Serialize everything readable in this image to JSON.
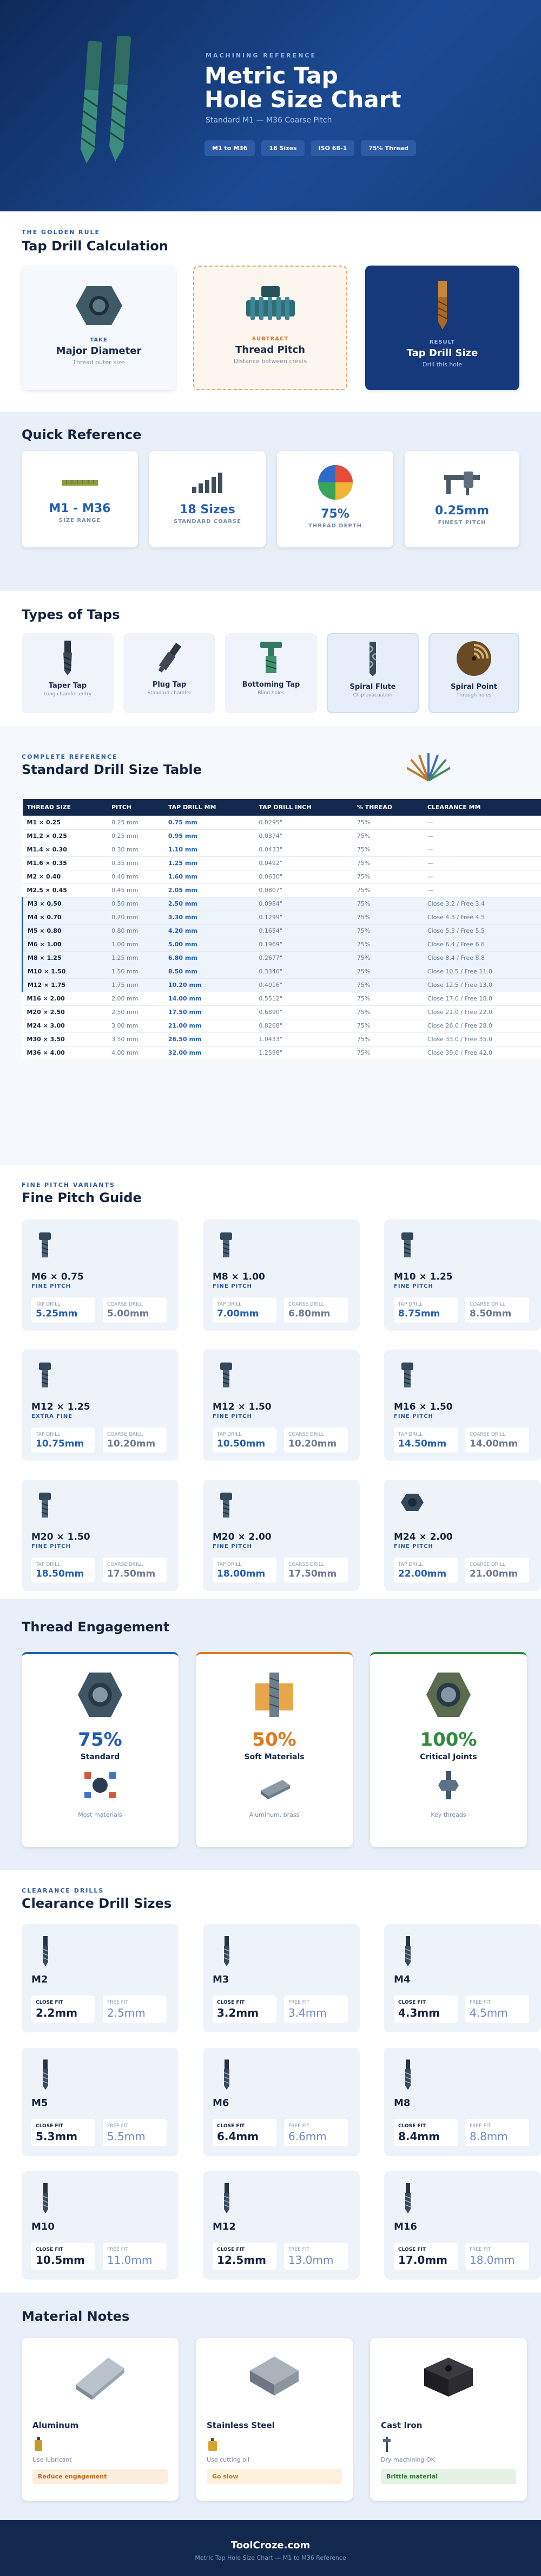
{
  "header": {
    "kicker": "MACHINING REFERENCE",
    "title_line1": "Metric Tap",
    "title_line2": "Hole Size Chart",
    "subtitle": "Standard M1 — M36 Coarse Pitch",
    "chips": [
      "M1 to M36",
      "18 Sizes",
      "ISO 68-1",
      "75% Thread"
    ]
  },
  "golden": {
    "kicker": "THE GOLDEN RULE",
    "title": "Tap Drill Calculation",
    "cards": [
      {
        "label": "TAKE",
        "title": "Major Diameter",
        "desc": "Thread outer size"
      },
      {
        "label": "SUBTRACT",
        "title": "Thread Pitch",
        "desc": "Distance between crests"
      },
      {
        "label": "RESULT",
        "title": "Tap Drill Size",
        "desc": "Drill this hole"
      }
    ]
  },
  "quick": {
    "title": "Quick Reference",
    "cards": [
      {
        "value": "M1 - M36",
        "label": "SIZE RANGE"
      },
      {
        "value": "18 Sizes",
        "label": "STANDARD COARSE"
      },
      {
        "value": "75%",
        "label": "THREAD DEPTH"
      },
      {
        "value": "0.25mm",
        "label": "FINEST PITCH"
      }
    ]
  },
  "taps": {
    "title": "Types of Taps",
    "items": [
      {
        "name": "Taper Tap",
        "desc": "Long chamfer entry"
      },
      {
        "name": "Plug Tap",
        "desc": "Standard chamfer"
      },
      {
        "name": "Bottoming Tap",
        "desc": "Blind holes"
      },
      {
        "name": "Spiral Flute",
        "desc": "Chip evacuation"
      },
      {
        "name": "Spiral Point",
        "desc": "Through holes"
      }
    ]
  },
  "table": {
    "kicker": "COMPLETE REFERENCE",
    "title": "Standard Drill Size Table",
    "headers": [
      "THREAD SIZE",
      "PITCH",
      "TAP DRILL MM",
      "TAP DRILL INCH",
      "% THREAD",
      "CLEARANCE MM"
    ],
    "rows": [
      [
        "M1 × 0.25",
        "0.25 mm",
        "0.75 mm",
        "0.0295\"",
        "75%",
        "—"
      ],
      [
        "M1.2 × 0.25",
        "0.25 mm",
        "0.95 mm",
        "0.0374\"",
        "75%",
        "—"
      ],
      [
        "M1.4 × 0.30",
        "0.30 mm",
        "1.10 mm",
        "0.0433\"",
        "75%",
        "—"
      ],
      [
        "M1.6 × 0.35",
        "0.35 mm",
        "1.25 mm",
        "0.0492\"",
        "75%",
        "—"
      ],
      [
        "M2 × 0.40",
        "0.40 mm",
        "1.60 mm",
        "0.0630\"",
        "75%",
        "—"
      ],
      [
        "M2.5 × 0.45",
        "0.45 mm",
        "2.05 mm",
        "0.0807\"",
        "75%",
        "—"
      ],
      [
        "M3 × 0.50",
        "0.50 mm",
        "2.50 mm",
        "0.0984\"",
        "75%",
        "Close 3.2 / Free 3.4"
      ],
      [
        "M4 × 0.70",
        "0.70 mm",
        "3.30 mm",
        "0.1299\"",
        "75%",
        "Close 4.3 / Free 4.5"
      ],
      [
        "M5 × 0.80",
        "0.80 mm",
        "4.20 mm",
        "0.1654\"",
        "75%",
        "Close 5.3 / Free 5.5"
      ],
      [
        "M6 × 1.00",
        "1.00 mm",
        "5.00 mm",
        "0.1969\"",
        "75%",
        "Close 6.4 / Free 6.6"
      ],
      [
        "M8 × 1.25",
        "1.25 mm",
        "6.80 mm",
        "0.2677\"",
        "75%",
        "Close 8.4 / Free 8.8"
      ],
      [
        "M10 × 1.50",
        "1.50 mm",
        "8.50 mm",
        "0.3346\"",
        "75%",
        "Close 10.5 / Free 11.0"
      ],
      [
        "M12 × 1.75",
        "1.75 mm",
        "10.20 mm",
        "0.4016\"",
        "75%",
        "Close 12.5 / Free 13.0"
      ],
      [
        "M16 × 2.00",
        "2.00 mm",
        "14.00 mm",
        "0.5512\"",
        "75%",
        "Close 17.0 / Free 18.0"
      ],
      [
        "M20 × 2.50",
        "2.50 mm",
        "17.50 mm",
        "0.6890\"",
        "75%",
        "Close 21.0 / Free 22.0"
      ],
      [
        "M24 × 3.00",
        "3.00 mm",
        "21.00 mm",
        "0.8268\"",
        "75%",
        "Close 26.0 / Free 28.0"
      ],
      [
        "M30 × 3.50",
        "3.50 mm",
        "26.50 mm",
        "1.0433\"",
        "75%",
        "Close 33.0 / Free 35.0"
      ],
      [
        "M36 × 4.00",
        "4.00 mm",
        "32.00 mm",
        "1.2598\"",
        "75%",
        "Close 39.0 / Free 42.0"
      ]
    ]
  },
  "fine": {
    "kicker": "FINE PITCH VARIANTS",
    "title": "Fine Pitch Guide",
    "tap_label": "TAP DRILL",
    "coarse_label": "COARSE DRILL",
    "items": [
      {
        "size": "M6 × 0.75",
        "tag": "FINE PITCH",
        "tap": "5.25mm",
        "coarse": "5.00mm"
      },
      {
        "size": "M8 × 1.00",
        "tag": "FINE PITCH",
        "tap": "7.00mm",
        "coarse": "6.80mm"
      },
      {
        "size": "M10 × 1.25",
        "tag": "FINE PITCH",
        "tap": "8.75mm",
        "coarse": "8.50mm"
      },
      {
        "size": "M12 × 1.25",
        "tag": "EXTRA FINE",
        "tap": "10.75mm",
        "coarse": "10.20mm"
      },
      {
        "size": "M12 × 1.50",
        "tag": "FINE PITCH",
        "tap": "10.50mm",
        "coarse": "10.20mm"
      },
      {
        "size": "M16 × 1.50",
        "tag": "FINE PITCH",
        "tap": "14.50mm",
        "coarse": "14.00mm"
      },
      {
        "size": "M20 × 1.50",
        "tag": "FINE PITCH",
        "tap": "18.50mm",
        "coarse": "17.50mm"
      },
      {
        "size": "M20 × 2.00",
        "tag": "FINE PITCH",
        "tap": "18.00mm",
        "coarse": "17.50mm"
      },
      {
        "size": "M24 × 2.00",
        "tag": "FINE PITCH",
        "tap": "22.00mm",
        "coarse": "21.00mm"
      }
    ]
  },
  "engage": {
    "title": "Thread Engagement",
    "cards": [
      {
        "pct": "75%",
        "name": "Standard",
        "use": "Most materials",
        "color": "#1f5db5"
      },
      {
        "pct": "50%",
        "name": "Soft Materials",
        "use": "Aluminum, brass",
        "color": "#e07a1f"
      },
      {
        "pct": "100%",
        "name": "Critical Joints",
        "use": "Key threads",
        "color": "#2e8b3e"
      }
    ]
  },
  "clear": {
    "kicker": "CLEARANCE DRILLS",
    "title": "Clearance Drill Sizes",
    "close_label": "CLOSE FIT",
    "free_label": "FREE FIT",
    "items": [
      {
        "size": "M2",
        "close": "2.2mm",
        "free": "2.5mm"
      },
      {
        "size": "M3",
        "close": "3.2mm",
        "free": "3.4mm"
      },
      {
        "size": "M4",
        "close": "4.3mm",
        "free": "4.5mm"
      },
      {
        "size": "M5",
        "close": "5.3mm",
        "free": "5.5mm"
      },
      {
        "size": "M6",
        "close": "6.4mm",
        "free": "6.6mm"
      },
      {
        "size": "M8",
        "close": "8.4mm",
        "free": "8.8mm"
      },
      {
        "size": "M10",
        "close": "10.5mm",
        "free": "11.0mm"
      },
      {
        "size": "M12",
        "close": "12.5mm",
        "free": "13.0mm"
      },
      {
        "size": "M16",
        "close": "17.0mm",
        "free": "18.0mm"
      }
    ]
  },
  "materials": {
    "title": "Material Notes",
    "items": [
      {
        "name": "Aluminum",
        "note": "Use lubricant",
        "badge": "Reduce engagement",
        "badge_color": "#fbeedd",
        "badge_text": "#c0681a"
      },
      {
        "name": "Stainless Steel",
        "note": "Use cutting oil",
        "badge": "Go slow",
        "badge_color": "#fdf1dc",
        "badge_text": "#b7791f"
      },
      {
        "name": "Cast Iron",
        "note": "Dry machining OK",
        "badge": "Brittle material",
        "badge_color": "#e4f1e4",
        "badge_text": "#2e7d32"
      }
    ]
  },
  "footer": {
    "site": "ToolCroze.com",
    "caption": "Metric Tap Hole Size Chart — M1 to M36 Reference"
  }
}
